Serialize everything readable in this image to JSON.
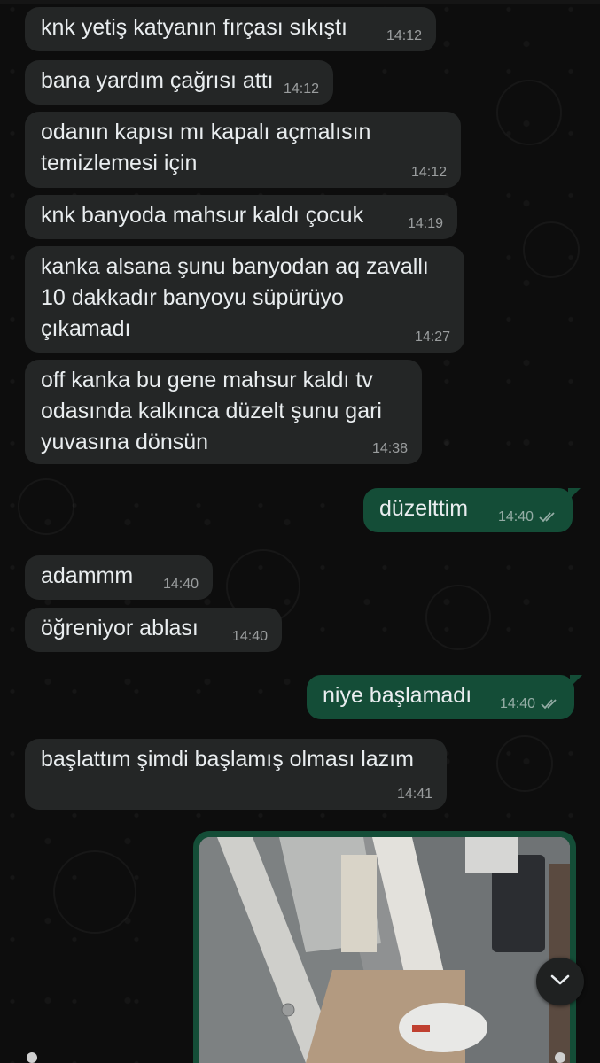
{
  "messages": [
    {
      "direction": "incoming",
      "text": "knk yetiş katyanın fırçası sıkıştı",
      "time": "14:12"
    },
    {
      "direction": "incoming",
      "text": "bana yardım çağrısı attı",
      "time": "14:12"
    },
    {
      "direction": "incoming",
      "text": "odanın kapısı mı kapalı açmalısın\ntemizlemesi için",
      "time": "14:12"
    },
    {
      "direction": "incoming",
      "text": "knk banyoda mahsur kaldı çocuk",
      "time": "14:19"
    },
    {
      "direction": "incoming",
      "text": "kanka alsana şunu banyodan aq zavallı\n10 dakkadır banyoyu süpürüyo\nçıkamadı",
      "time": "14:27"
    },
    {
      "direction": "incoming",
      "text": "off kanka bu gene mahsur kaldı tv\nodasında kalkınca düzelt şunu gari\nyuvasına dönsün",
      "time": "14:38"
    },
    {
      "direction": "outgoing",
      "text": "düzelttim",
      "time": "14:40",
      "status": "read-double-check-icon"
    },
    {
      "direction": "incoming",
      "text": "adammm",
      "time": "14:40"
    },
    {
      "direction": "incoming",
      "text": "öğreniyor ablası",
      "time": "14:40"
    },
    {
      "direction": "outgoing",
      "text": "niye başlamadı",
      "time": "14:40",
      "status": "read-double-check-icon"
    },
    {
      "direction": "incoming",
      "text": "başlattım şimdi başlamış olması lazım",
      "time": "14:41"
    }
  ],
  "media_message": {
    "direction": "outgoing",
    "kind": "photo",
    "icon": "photo-thumbnail"
  },
  "scroll_to_bottom": {
    "icon": "chevron-down-icon"
  },
  "colors": {
    "incoming_bubble": "#242626",
    "outgoing_bubble": "#144d37",
    "text": "#e9edef",
    "background": "#0d0d0d"
  }
}
